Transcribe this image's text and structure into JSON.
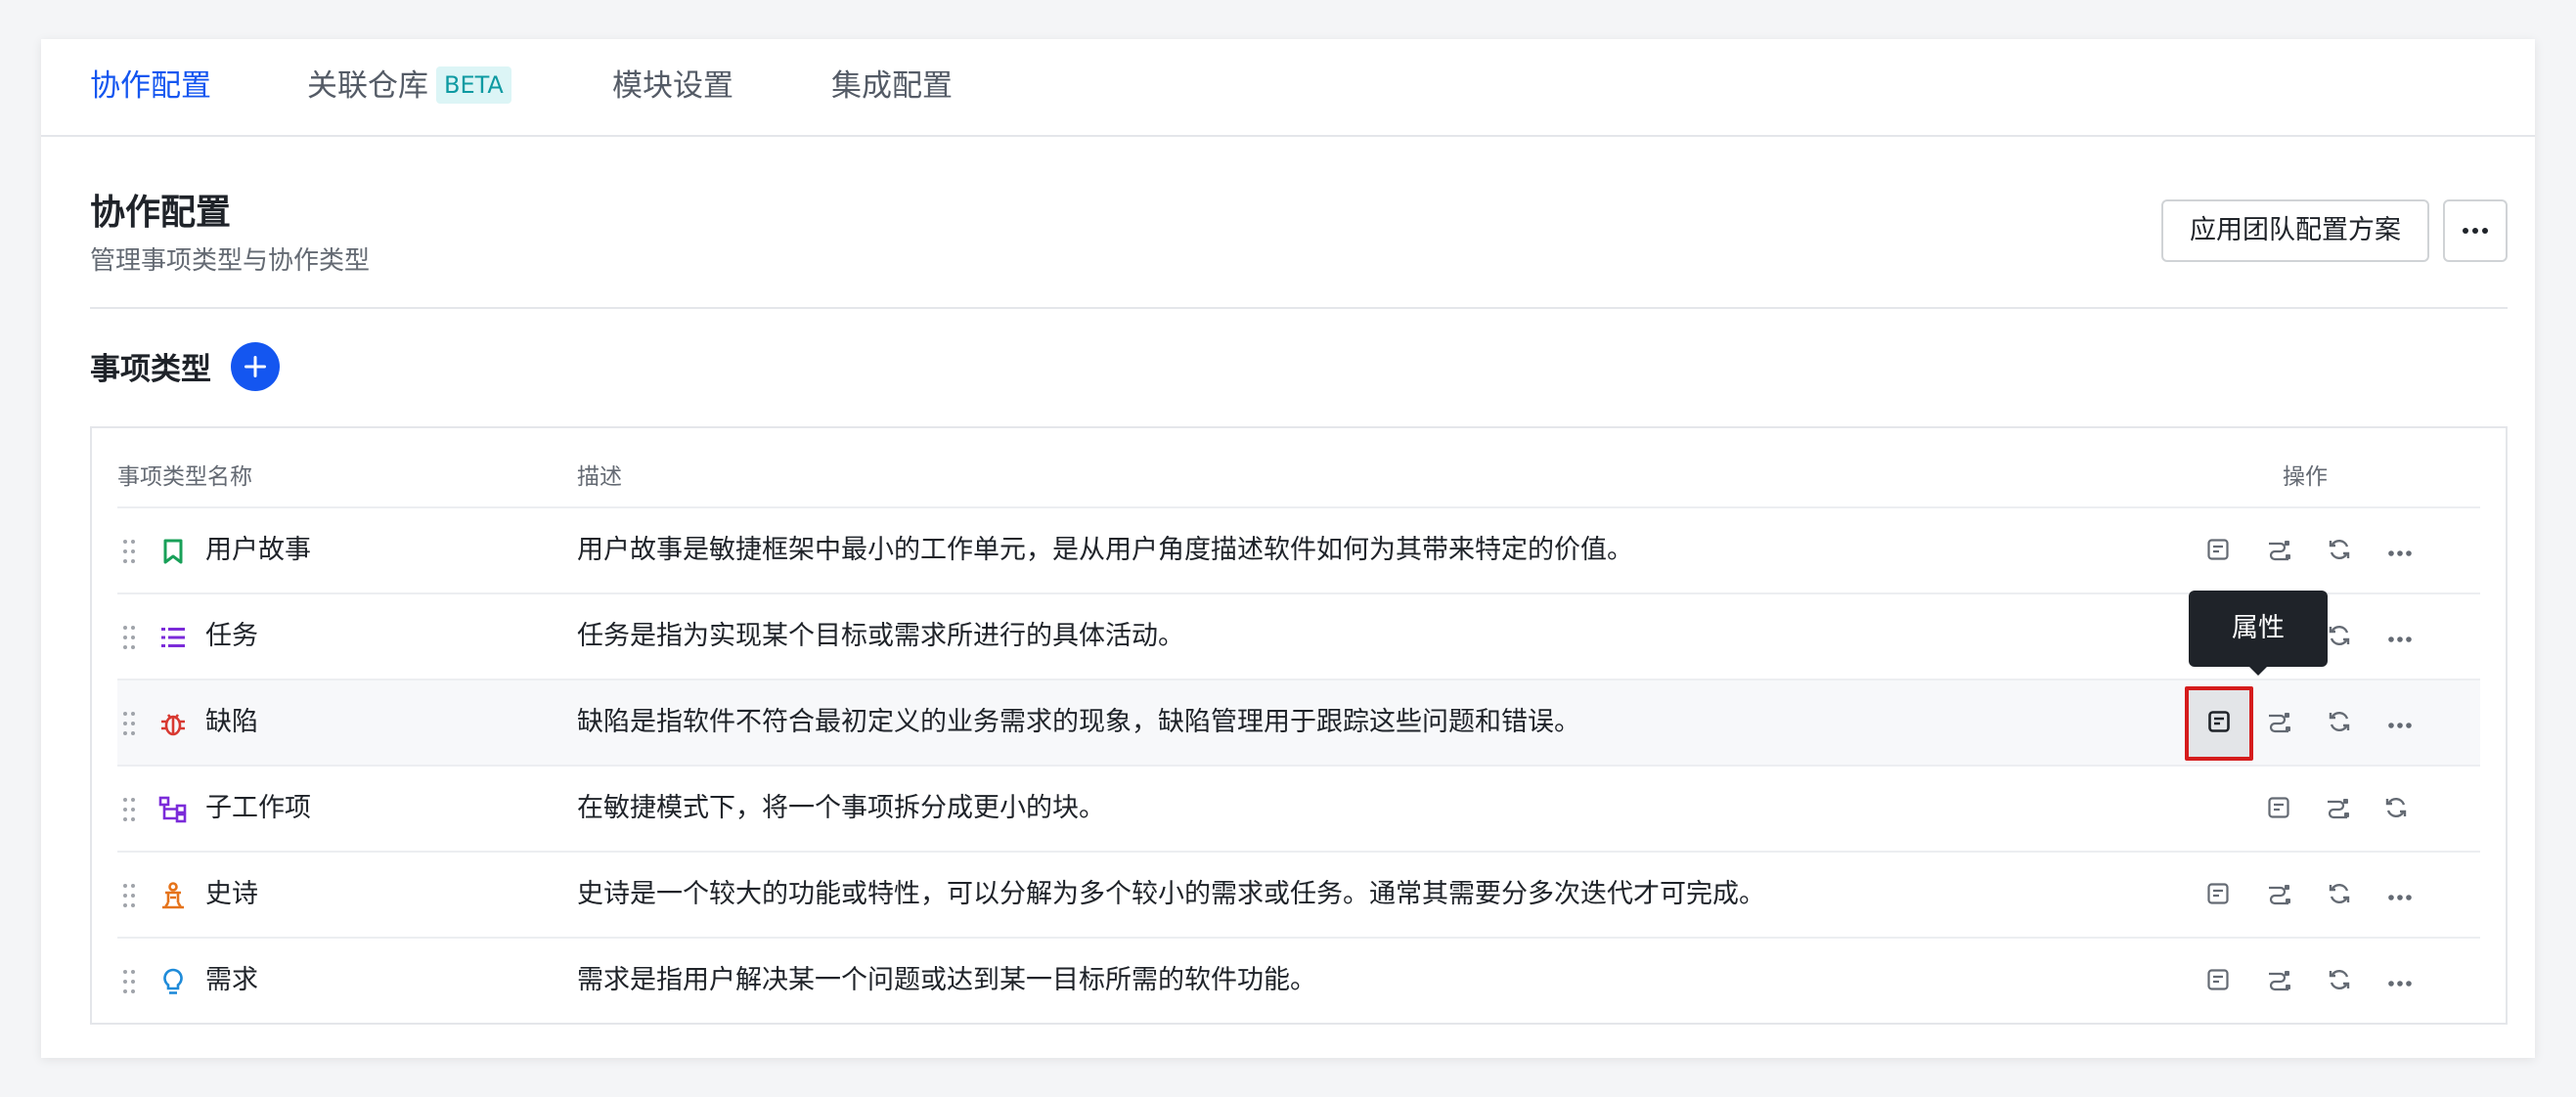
{
  "tabs": [
    {
      "label": "协作配置",
      "active": true
    },
    {
      "label": "关联仓库",
      "badge": "BETA"
    },
    {
      "label": "模块设置"
    },
    {
      "label": "集成配置"
    }
  ],
  "header": {
    "title": "协作配置",
    "subtitle": "管理事项类型与协作类型",
    "apply_label": "应用团队配置方案",
    "more_icon": "more-horizontal-icon"
  },
  "section": {
    "title": "事项类型",
    "add_icon": "plus-icon"
  },
  "table": {
    "columns": [
      "事项类型名称",
      "描述",
      "操作"
    ],
    "rows": [
      {
        "name": "用户故事",
        "icon": "bookmark-icon",
        "color": "#18a058",
        "desc": "用户故事是敏捷框架中最小的工作单元，是从用户角度描述软件如何为其带来特定的价值。"
      },
      {
        "name": "任务",
        "icon": "list-icon",
        "color": "#7b2bd9",
        "desc": "任务是指为实现某个目标或需求所进行的具体活动。"
      },
      {
        "name": "缺陷",
        "icon": "bug-icon",
        "color": "#d83931",
        "desc": "缺陷是指软件不符合最初定义的业务需求的现象，缺陷管理用于跟踪这些问题和错误。"
      },
      {
        "name": "子工作项",
        "icon": "subtask-icon",
        "color": "#7b2bd9",
        "desc": "在敏捷模式下，将一个事项拆分成更小的块。"
      },
      {
        "name": "史诗",
        "icon": "epic-icon",
        "color": "#e5731a",
        "desc": "史诗是一个较大的功能或特性，可以分解为多个较小的需求或任务。通常其需要分多次迭代才可完成。"
      },
      {
        "name": "需求",
        "icon": "lightbulb-icon",
        "color": "#1f8bd9",
        "desc": "需求是指用户解决某一个问题或达到某一目标所需的软件功能。"
      }
    ]
  },
  "tooltip": {
    "text": "属性"
  },
  "action_icons": [
    "properties-icon",
    "workflow-icon",
    "refresh-icon",
    "more-horizontal-icon"
  ]
}
